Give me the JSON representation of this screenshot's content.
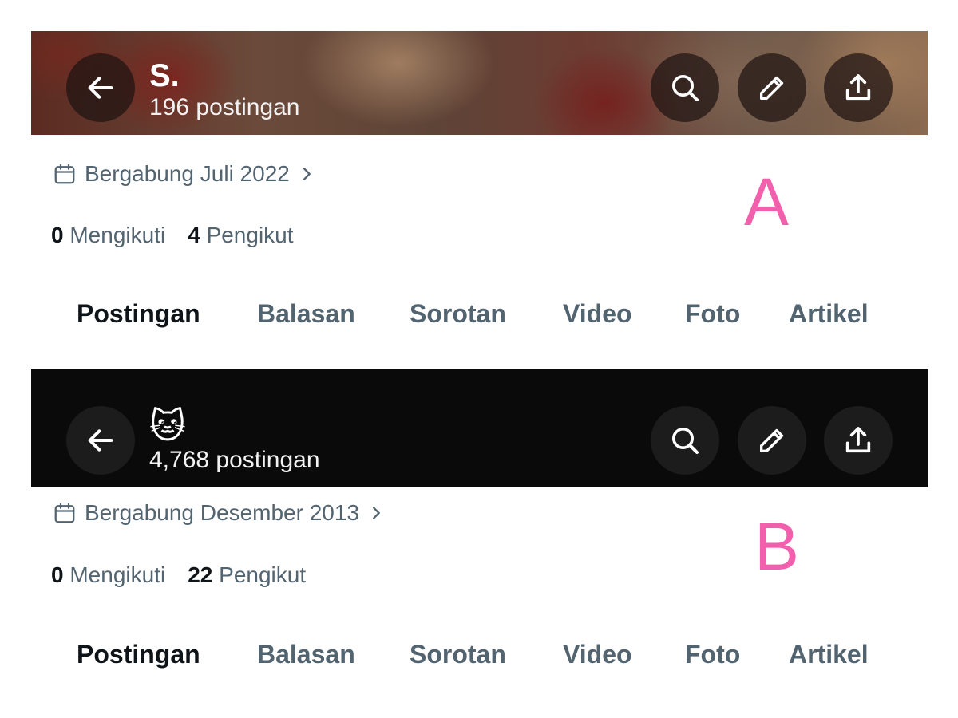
{
  "profiles": [
    {
      "marker": "A",
      "name": "S.",
      "posts": "196 postingan",
      "joined": "Bergabung Juli 2022",
      "following_count": "0",
      "following_label": "Mengikuti",
      "followers_count": "4",
      "followers_label": "Pengikut"
    },
    {
      "marker": "B",
      "name": "🐱",
      "posts": "4,768 postingan",
      "joined": "Bergabung Desember 2013",
      "following_count": "0",
      "following_label": "Mengikuti",
      "followers_count": "22",
      "followers_label": "Pengikut"
    }
  ],
  "tabs": [
    "Postingan",
    "Balasan",
    "Sorotan",
    "Video",
    "Foto",
    "Artikel"
  ],
  "active_tab": "Postingan",
  "icons": {
    "back": "arrow-left-icon",
    "search": "search-icon",
    "edit": "pencil-icon",
    "share": "share-upload-icon",
    "calendar": "calendar-icon",
    "chevron": "chevron-right-icon"
  },
  "colors": {
    "marker": "#f25fac",
    "text_primary": "#0f1419",
    "text_secondary": "#536471",
    "header_b_bg": "#0a0a0a"
  }
}
